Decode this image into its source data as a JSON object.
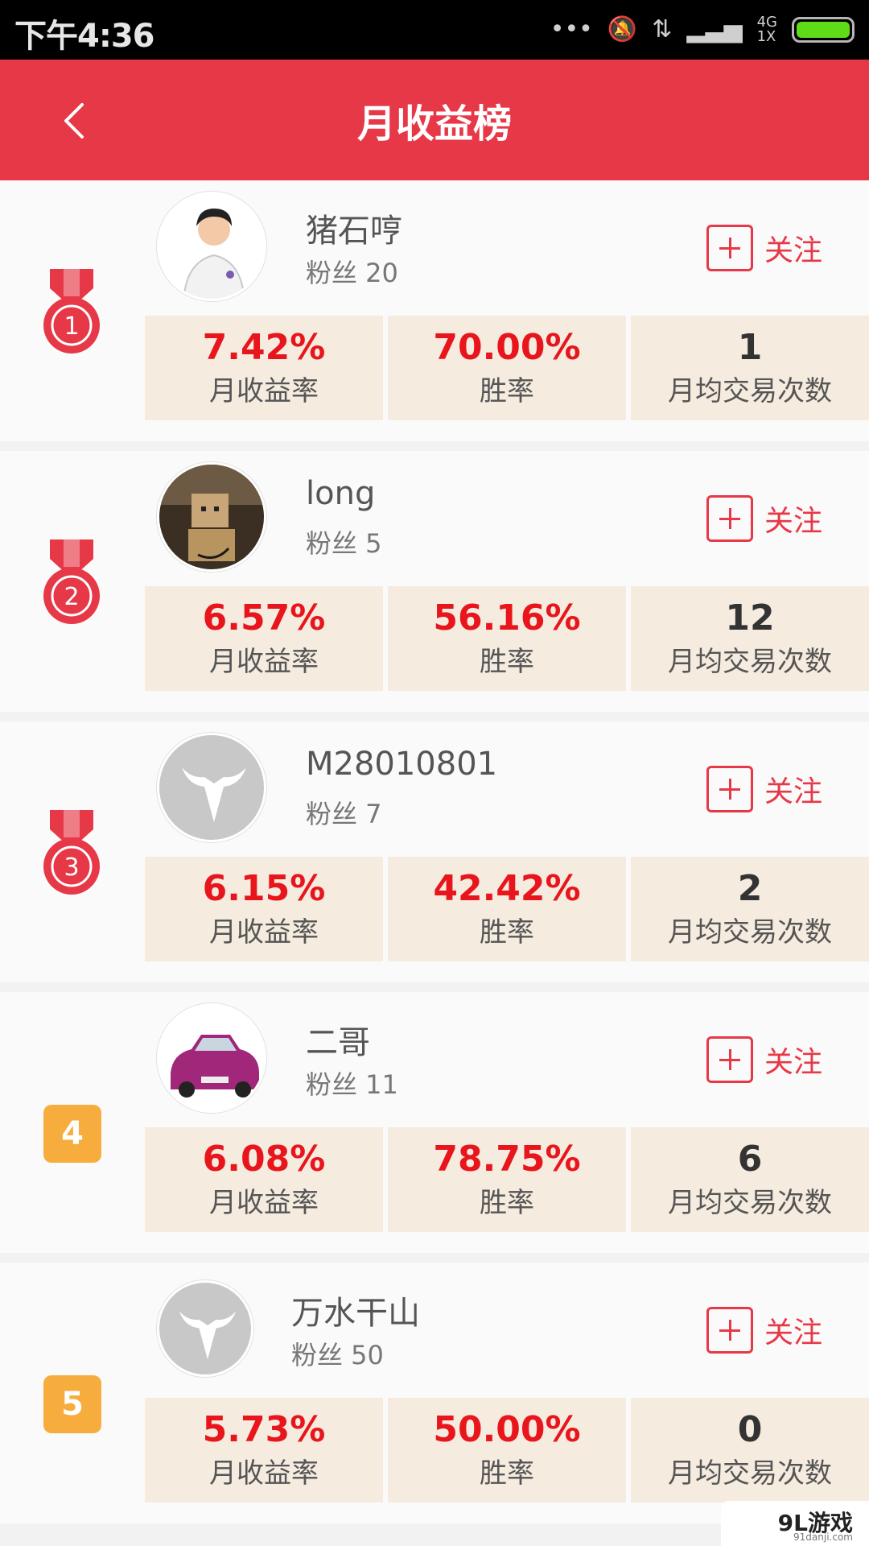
{
  "status_bar": {
    "time": "下午4:36",
    "network_top": "4G",
    "network_bottom": "1X"
  },
  "header": {
    "title": "月收益榜"
  },
  "list": [
    {
      "rank": "1",
      "name": "猪石哼",
      "fans": "粉丝 20",
      "follow": "关注",
      "stats": [
        {
          "value": "7.42%",
          "label": "月收益率"
        },
        {
          "value": "70.00%",
          "label": "胜率"
        },
        {
          "value": "1",
          "label": "月均交易次数"
        }
      ]
    },
    {
      "rank": "2",
      "name": "long",
      "fans": "粉丝 5",
      "follow": "关注",
      "stats": [
        {
          "value": "6.57%",
          "label": "月收益率"
        },
        {
          "value": "56.16%",
          "label": "胜率"
        },
        {
          "value": "12",
          "label": "月均交易次数"
        }
      ]
    },
    {
      "rank": "3",
      "name": "M28010801",
      "fans": "粉丝 7",
      "follow": "关注",
      "stats": [
        {
          "value": "6.15%",
          "label": "月收益率"
        },
        {
          "value": "42.42%",
          "label": "胜率"
        },
        {
          "value": "2",
          "label": "月均交易次数"
        }
      ]
    },
    {
      "rank": "4",
      "name": "二哥",
      "fans": "粉丝 11",
      "follow": "关注",
      "stats": [
        {
          "value": "6.08%",
          "label": "月收益率"
        },
        {
          "value": "78.75%",
          "label": "胜率"
        },
        {
          "value": "6",
          "label": "月均交易次数"
        }
      ]
    },
    {
      "rank": "5",
      "name": "万水干山",
      "fans": "粉丝 50",
      "follow": "关注",
      "stats": [
        {
          "value": "5.73%",
          "label": "月收益率"
        },
        {
          "value": "50.00%",
          "label": "胜率"
        },
        {
          "value": "0",
          "label": "月均交易次数"
        }
      ]
    }
  ],
  "watermark": {
    "title": "9L游戏",
    "site": "91danji.com"
  },
  "colors": {
    "header": "#e73848",
    "value_red": "#e8161c",
    "stat_bg": "#f5ebdf",
    "rank_box": "#f7ad3e"
  }
}
